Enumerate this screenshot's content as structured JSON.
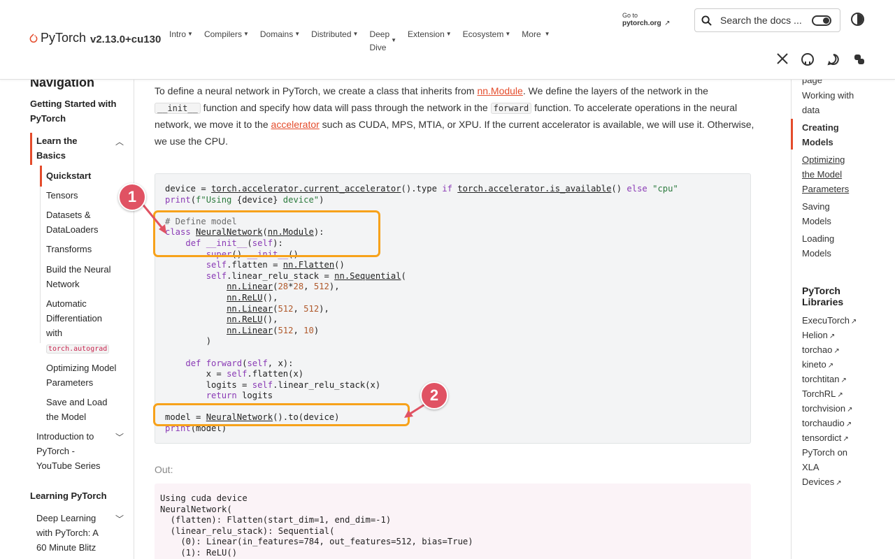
{
  "header": {
    "logo_text": "PyTorch",
    "version": "v2.13.0+cu130",
    "nav": [
      "Intro",
      "Compilers",
      "Domains",
      "Distributed",
      "Extension",
      "Ecosystem",
      "More"
    ],
    "nav_deep_line1": "Deep",
    "nav_deep_line2": "Dive",
    "goto_small": "Go to",
    "goto_link": "pytorch.org",
    "search_placeholder": "Search the docs ..."
  },
  "sidebar": {
    "title": "Navigation",
    "group1": "Getting Started with PyTorch",
    "learn_basics": "Learn the Basics",
    "items": [
      "Quickstart",
      "Tensors",
      "Datasets & DataLoaders",
      "Transforms",
      "Build the Neural Network",
      "Automatic Differentiation with",
      "Optimizing Model Parameters",
      "Save and Load the Model"
    ],
    "autograd_chip": "torch.autograd",
    "intro_series": "Introduction to PyTorch - YouTube Series",
    "group2": "Learning PyTorch",
    "deep_learning": "Deep Learning with PyTorch: A 60 Minute Blitz"
  },
  "main": {
    "para_1": "To define a neural network in PyTorch, we create a class that inherits from ",
    "para_link1": "nn.Module",
    "para_2": ". We define the layers of the network in the ",
    "para_code1": "__init__",
    "para_3": " function and specify how data will pass through the network in the ",
    "para_code2": "forward",
    "para_4": " function. To accelerate operations in the neural network, we move it to the ",
    "para_link2": "accelerator",
    "para_5": " such as CUDA, MPS, MTIA, or XPU. If the current accelerator is available, we will use it. Otherwise, we use the CPU.",
    "out_label": "Out:",
    "output_lines": [
      "Using cuda device",
      "NeuralNetwork(",
      "  (flatten): Flatten(start_dim=1, end_dim=-1)",
      "  (linear_relu_stack): Sequential(",
      "    (0): Linear(in_features=784, out_features=512, bias=True)",
      "    (1): ReLU()"
    ]
  },
  "annotations": {
    "badge1": "1",
    "badge2": "2",
    "highlight_color": "#f7a21b",
    "badge_color": "#e05263"
  },
  "toc": {
    "items_top": [
      "page",
      "Working with data"
    ],
    "active": "Creating Models",
    "items": [
      "Optimizing the Model Parameters",
      "Saving Models",
      "Loading Models"
    ],
    "libraries_title": "PyTorch Libraries",
    "libraries": [
      "ExecuTorch",
      "Helion",
      "torchao",
      "kineto",
      "torchtitan",
      "TorchRL",
      "torchvision",
      "torchaudio",
      "tensordict",
      "PyTorch on XLA Devices"
    ]
  },
  "colors": {
    "accent": "#e44c2c"
  }
}
